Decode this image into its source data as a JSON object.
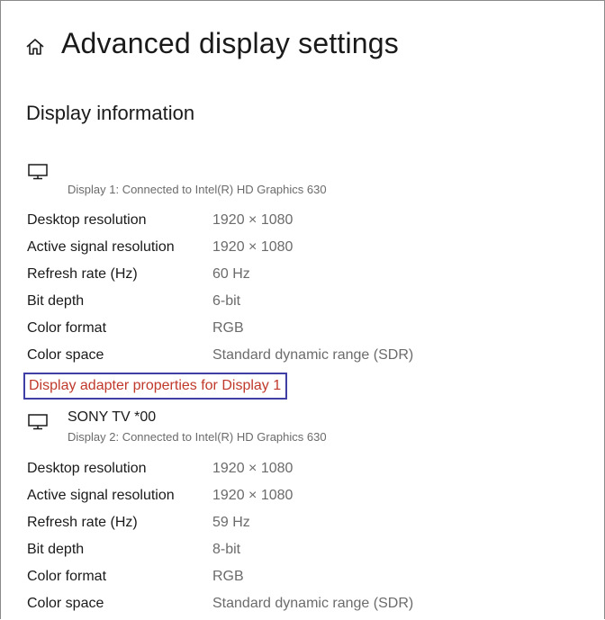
{
  "header": {
    "title": "Advanced display settings",
    "icon": "home-icon"
  },
  "section": {
    "title": "Display information"
  },
  "displays": [
    {
      "name": "",
      "subtitle": "Display 1: Connected to Intel(R) HD Graphics 630",
      "icon": "monitor-icon",
      "rows": [
        {
          "label": "Desktop resolution",
          "value": "1920 × 1080"
        },
        {
          "label": "Active signal resolution",
          "value": "1920 × 1080"
        },
        {
          "label": "Refresh rate (Hz)",
          "value": "60 Hz"
        },
        {
          "label": "Bit depth",
          "value": "6-bit"
        },
        {
          "label": "Color format",
          "value": "RGB"
        },
        {
          "label": "Color space",
          "value": "Standard dynamic range (SDR)"
        }
      ],
      "adapter_link": "Display adapter properties for Display 1"
    },
    {
      "name": "SONY TV  *00",
      "subtitle": "Display 2: Connected to Intel(R) HD Graphics 630",
      "icon": "monitor-icon",
      "rows": [
        {
          "label": "Desktop resolution",
          "value": "1920 × 1080"
        },
        {
          "label": "Active signal resolution",
          "value": "1920 × 1080"
        },
        {
          "label": "Refresh rate (Hz)",
          "value": "59 Hz"
        },
        {
          "label": "Bit depth",
          "value": "8-bit"
        },
        {
          "label": "Color format",
          "value": "RGB"
        },
        {
          "label": "Color space",
          "value": "Standard dynamic range (SDR)"
        }
      ]
    }
  ],
  "colors": {
    "link": "#c0392b",
    "focus_border": "#3f3fa6",
    "secondary_text": "#6b6b6b"
  }
}
